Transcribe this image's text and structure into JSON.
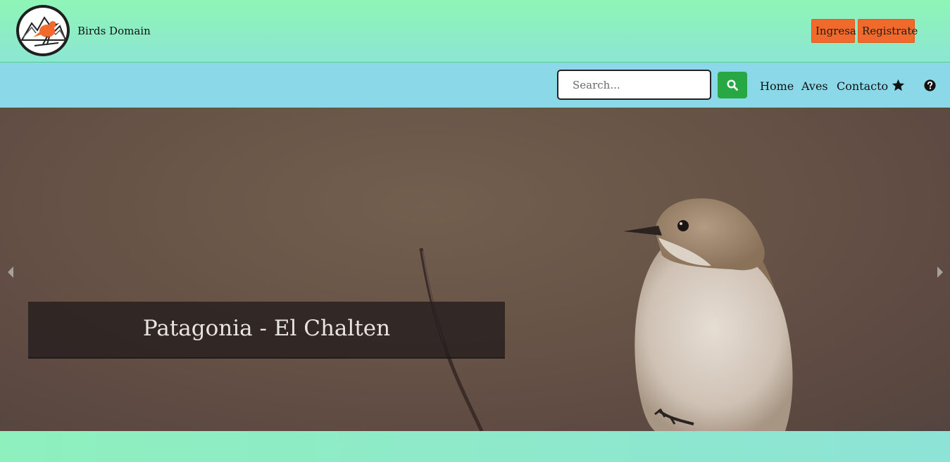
{
  "header": {
    "brand": "Birds Domain",
    "login_label": "Ingresa",
    "register_label": "Registrate"
  },
  "nav": {
    "search_placeholder": "Search...",
    "links": [
      "Home",
      "Aves",
      "Contacto"
    ],
    "icons": [
      "search-icon",
      "star-icon",
      "question-circle-icon"
    ]
  },
  "hero": {
    "caption": "Patagonia - El Chalten"
  },
  "colors": {
    "accent_orange": "#f26a2b",
    "search_green": "#27a844",
    "header_green": "#8ef5b6",
    "nav_blue": "#8bd8e8"
  }
}
